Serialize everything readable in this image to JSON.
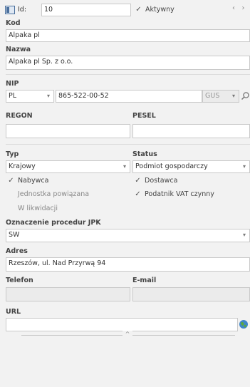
{
  "header": {
    "id_label": "Id:",
    "id_value": "10",
    "active_label": "Aktywny",
    "active_checked": true
  },
  "kod": {
    "label": "Kod",
    "value": "Alpaka pl"
  },
  "nazwa": {
    "label": "Nazwa",
    "value": "Alpaka pl Sp. z o.o."
  },
  "nip": {
    "label": "NIP",
    "country": "PL",
    "value": "865-522-00-52",
    "gus": "GUS"
  },
  "regon": {
    "label": "REGON",
    "value": ""
  },
  "pesel": {
    "label": "PESEL",
    "value": ""
  },
  "typ": {
    "label": "Typ",
    "value": "Krajowy"
  },
  "status": {
    "label": "Status",
    "value": "Podmiot gospodarczy"
  },
  "checkboxes": {
    "nabywca": {
      "label": "Nabywca",
      "checked": true
    },
    "dostawca": {
      "label": "Dostawca",
      "checked": true
    },
    "jednostka": {
      "label": "Jednostka powiązana",
      "checked": false
    },
    "vat": {
      "label": "Podatnik VAT czynny",
      "checked": true
    },
    "likwidacja": {
      "label": "W likwidacji",
      "checked": false
    }
  },
  "jpk": {
    "label": "Oznaczenie procedur JPK",
    "value": "SW"
  },
  "adres": {
    "label": "Adres",
    "value": "Rzeszów, ul. Nad Przyrwą 94"
  },
  "telefon": {
    "label": "Telefon",
    "value": ""
  },
  "email": {
    "label": "E-mail",
    "value": ""
  },
  "url": {
    "label": "URL",
    "value": ""
  },
  "icons": {
    "id": "card-icon",
    "nav": "chevron-arrows-icon",
    "dropdown": "chevron-down-icon",
    "search": "magnifier-icon",
    "globe": "globe-icon",
    "collapse": "chevron-up-icon"
  }
}
